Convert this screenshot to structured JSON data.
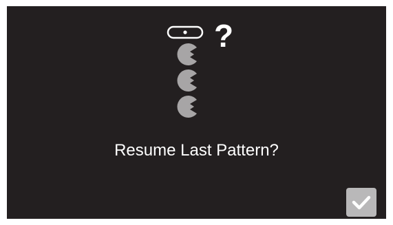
{
  "dialog": {
    "prompt": "Resume Last Pattern?",
    "question_mark": "?",
    "confirm_icon": "checkmark-icon",
    "pattern_icon": "stitch-pattern-icon"
  },
  "colors": {
    "background": "#231f20",
    "text": "#ffffff",
    "stitch_gray": "#a7a5a6",
    "button": "#b9b8b9"
  }
}
